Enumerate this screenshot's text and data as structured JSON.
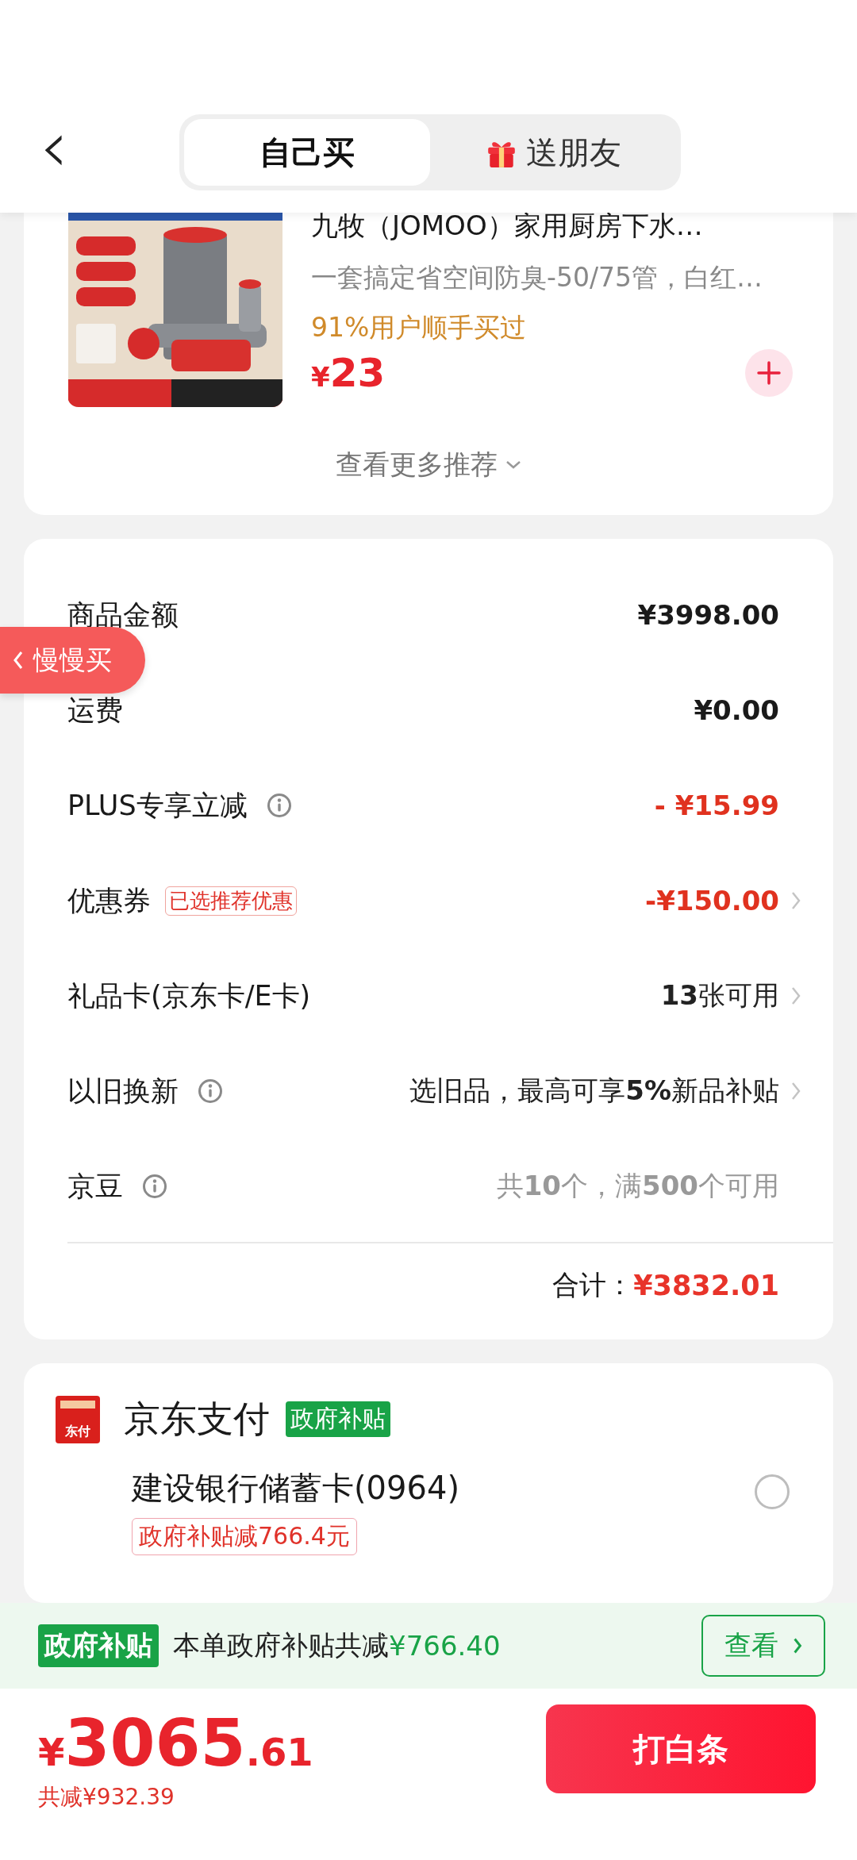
{
  "header": {
    "back": "‹",
    "tabs": [
      {
        "label": "自己买",
        "selected": true
      },
      {
        "label": "送朋友",
        "selected": false
      }
    ]
  },
  "recommend": {
    "product": {
      "title": "九牧（JOMOO）家用厨房下水…",
      "subtitle": "一套搞定省空间防臭-50/75管，白红…",
      "social": "91%用户顺手买过",
      "currency": "¥",
      "price": "23"
    },
    "more": "查看更多推荐"
  },
  "float_tab": {
    "label": "慢慢买"
  },
  "summary": {
    "rows": [
      {
        "kind": "amount",
        "label": "商品金额",
        "info": false,
        "value": "¥3998.00",
        "arrow": false
      },
      {
        "kind": "amount",
        "label": "运费",
        "info": false,
        "value": "¥0.00",
        "arrow": false
      },
      {
        "kind": "discount",
        "label": "PLUS专享立减",
        "info": true,
        "value": "- ¥15.99",
        "arrow": false
      },
      {
        "kind": "discount",
        "label": "优惠券",
        "info": false,
        "tag": "已选推荐优惠",
        "value": "-¥150.00",
        "arrow": true
      },
      {
        "kind": "option",
        "label": "礼品卡(京东卡/E卡)",
        "info": false,
        "value": "**13**张可用",
        "arrow": true
      },
      {
        "kind": "option",
        "label": "以旧换新",
        "info": true,
        "value": "选旧品，最高可享**5%**新品补贴",
        "arrow": true
      },
      {
        "kind": "hint",
        "label": "京豆",
        "info": true,
        "value": "共**10**个，满**500**个可用",
        "arrow": false
      }
    ],
    "total_label": "合计：",
    "total_value": "¥3832.01"
  },
  "payment": {
    "logo": "东付",
    "name": "京东支付",
    "badge": "政府补贴",
    "options": [
      {
        "name": "建设银行储蓄卡(0964)",
        "tag": "政府补贴减766.4元",
        "selected": false
      }
    ]
  },
  "subsidy_bar": {
    "badge": "政府补贴",
    "text": "本单政府补贴共减",
    "amount": "¥766.40",
    "button": "查看"
  },
  "checkout": {
    "currency": "¥",
    "integer": "3065",
    "decimal": ".61",
    "saved": "共减¥932.39",
    "button": "打白条"
  }
}
